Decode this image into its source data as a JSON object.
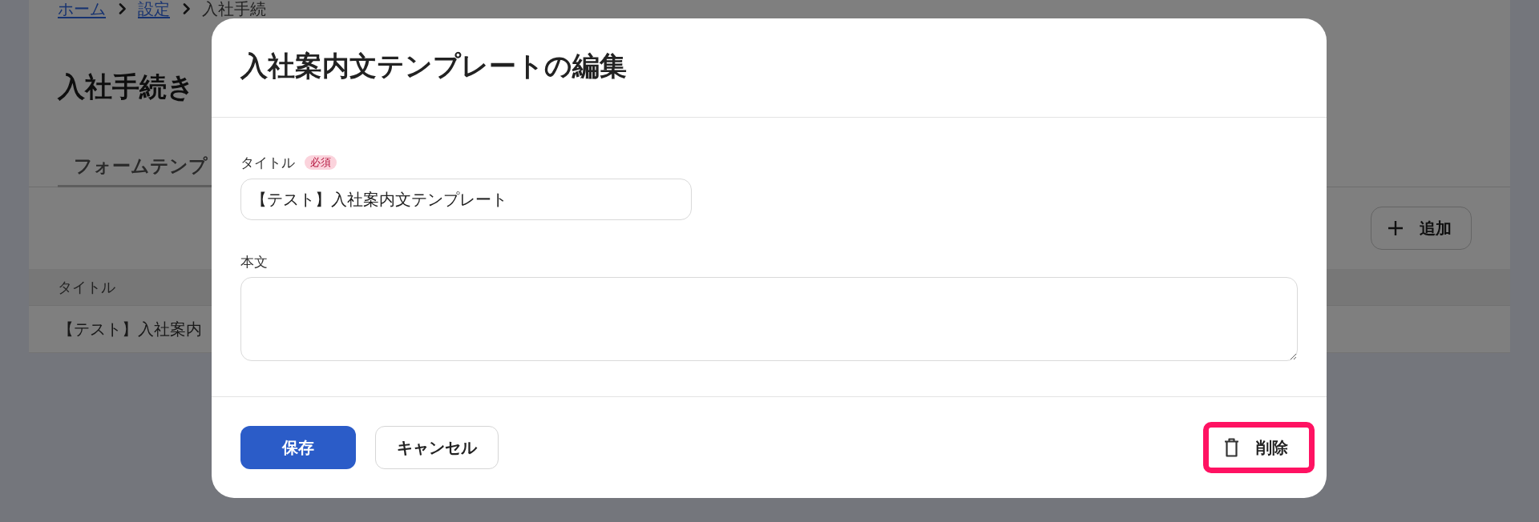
{
  "breadcrumb": [
    {
      "label": "ホーム",
      "kind": "link"
    },
    {
      "label": "設定",
      "kind": "link"
    },
    {
      "label": "入社手続",
      "kind": "current"
    }
  ],
  "page": {
    "title": "入社手続き"
  },
  "tabs": [
    {
      "label": "フォームテンプ",
      "selected": true
    }
  ],
  "toolbar": {
    "add_button": {
      "label": "追加"
    }
  },
  "table": {
    "columns": [
      "タイトル"
    ],
    "rows": [
      [
        "【テスト】入社案内"
      ]
    ]
  },
  "dialog": {
    "title": "入社案内文テンプレートの編集",
    "fields": [
      {
        "kind": "input",
        "label": "タイトル",
        "badge": "必須",
        "value": "【テスト】入社案内文テンプレート"
      },
      {
        "kind": "textarea",
        "label": "本文"
      }
    ],
    "buttons": [
      {
        "kind": "primary",
        "label": "保存",
        "highlighted": false
      },
      {
        "kind": "secondary",
        "label": "キャンセル",
        "highlighted": false
      },
      {
        "kind": "danger",
        "label": "削除",
        "highlighted": true
      }
    ]
  }
}
